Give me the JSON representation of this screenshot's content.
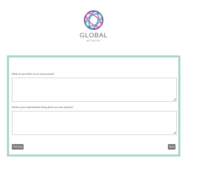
{
  "brand": {
    "name": "GLOBAL",
    "tagline": "NETWORK",
    "colors": {
      "ring_purple": "#7b5ea7",
      "ring_teal": "#3fb8b0",
      "ring_pink": "#d96aa7",
      "ring_blue": "#4a7fc1"
    }
  },
  "survey": {
    "frame_color": "#a8d7cb",
    "questions": [
      {
        "label": "What do you think of our new product?",
        "value": ""
      },
      {
        "label": "What is your least favorite thing about our new product?",
        "value": ""
      }
    ],
    "previous_label": "Previous",
    "next_label": "Next",
    "button_color": "#7a7a7a"
  }
}
